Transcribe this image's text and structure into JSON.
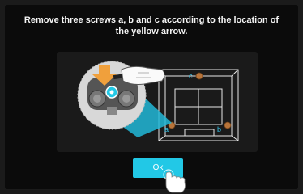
{
  "dialog": {
    "instruction": "Remove three screws a, b and c according to the location of the yellow arrow.",
    "ok_label": "Ok"
  },
  "diagram": {
    "screw_labels": [
      "a",
      "b",
      "c"
    ]
  },
  "colors": {
    "accent": "#22c8e6",
    "arrow": "#f0a03c",
    "screw": "#b8743a",
    "background": "#0b0b0b"
  }
}
